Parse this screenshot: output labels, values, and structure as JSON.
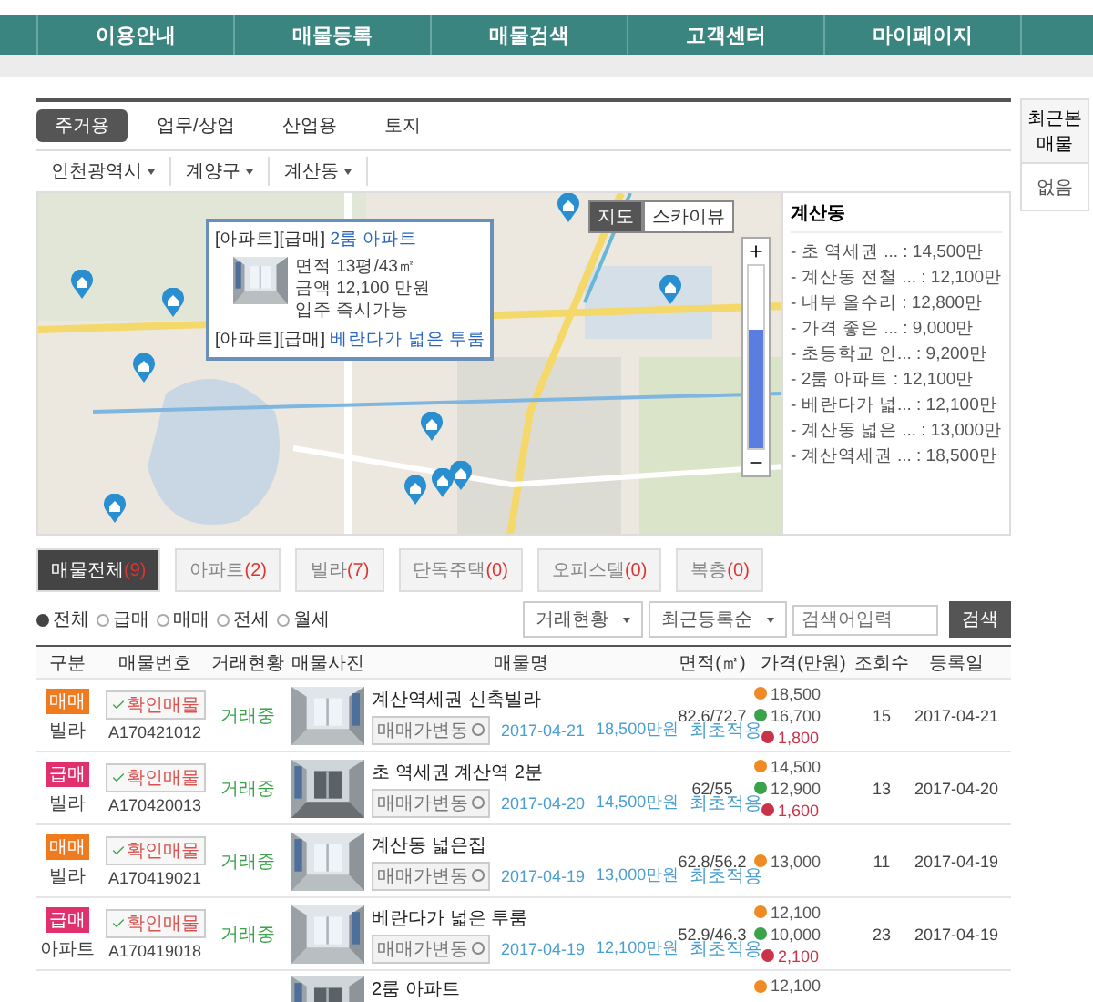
{
  "nav": [
    "이용안내",
    "매물등록",
    "매물검색",
    "고객센터",
    "마이페이지"
  ],
  "category_tabs": [
    {
      "label": "주거용",
      "selected": true
    },
    {
      "label": "업무/상업",
      "selected": false
    },
    {
      "label": "산업용",
      "selected": false
    },
    {
      "label": "토지",
      "selected": false
    }
  ],
  "breadcrumb": [
    "인천광역시",
    "계양구",
    "계산동"
  ],
  "map": {
    "map_types": [
      {
        "label": "지도",
        "selected": true
      },
      {
        "label": "스카이뷰",
        "selected": false
      }
    ],
    "zoom": {
      "level": 0.65
    },
    "popup": {
      "items": [
        {
          "tags": "[아파트][급매]",
          "title": "2룸 아파트",
          "details": [
            "면적 13평/43㎡",
            "금액 12,100 만원",
            "입주 즉시가능"
          ]
        },
        {
          "tags": "[아파트][급매]",
          "title": "베란다가 넓은 투룸"
        }
      ]
    },
    "list": {
      "title": "계산동",
      "items": [
        "- 초 역세권 ... : 14,500만",
        "- 계산동 전철 ... : 12,100만",
        "- 내부 올수리 : 12,800만",
        "- 가격 좋은 ... : 9,000만",
        "- 초등학교 인... : 9,200만",
        "- 2룸 아파트 : 12,100만",
        "- 베란다가 넓... : 12,100만",
        "- 계산동 넓은 ... : 13,000만",
        "- 계산역세권 ... : 18,500만"
      ]
    }
  },
  "property_tabs": [
    {
      "label": "매물전체",
      "count": "(9)",
      "selected": true
    },
    {
      "label": "아파트",
      "count": "(2)",
      "selected": false
    },
    {
      "label": "빌라",
      "count": "(7)",
      "selected": false
    },
    {
      "label": "단독주택",
      "count": "(0)",
      "selected": false
    },
    {
      "label": "오피스텔",
      "count": "(0)",
      "selected": false
    },
    {
      "label": "복층",
      "count": "(0)",
      "selected": false
    }
  ],
  "filter": {
    "options": [
      {
        "label": "전체",
        "selected": true
      },
      {
        "label": "급매",
        "selected": false
      },
      {
        "label": "매매",
        "selected": false
      },
      {
        "label": "전세",
        "selected": false
      },
      {
        "label": "월세",
        "selected": false
      }
    ],
    "selects": [
      "거래현황",
      "최근등록순"
    ],
    "search": {
      "placeholder": "검색어입력"
    },
    "button": "검색"
  },
  "table": {
    "columns": [
      "구분",
      "매물번호",
      "거래현황",
      "매물사진",
      "매물명",
      "면적(㎡)",
      "가격(만원)",
      "조회수",
      "등록일"
    ],
    "rows": [
      {
        "tag": {
          "label": "매매",
          "color": "#f07a1e"
        },
        "type": "빌라",
        "verified": "확인매물",
        "id": "A170421012",
        "status": "거래중",
        "name": "계산역세권 신축빌라",
        "change": "매매가변동",
        "date": "2017-04-21",
        "price": "18,500만원",
        "note": "최초적용",
        "area": "82.6/72.7",
        "prices": [
          {
            "kind": "sale",
            "value": "18,500"
          },
          {
            "kind": "loan",
            "value": "16,700"
          },
          {
            "kind": "gap",
            "value": "1,800"
          }
        ],
        "views": "15",
        "registered": "2017-04-21"
      },
      {
        "tag": {
          "label": "급매",
          "color": "#e0306e"
        },
        "type": "빌라",
        "verified": "확인매물",
        "id": "A170420013",
        "status": "거래중",
        "name": "초 역세권 계산역 2분",
        "change": "매매가변동",
        "date": "2017-04-20",
        "price": "14,500만원",
        "note": "최초적용",
        "area": "62/55",
        "prices": [
          {
            "kind": "sale",
            "value": "14,500"
          },
          {
            "kind": "loan",
            "value": "12,900"
          },
          {
            "kind": "gap",
            "value": "1,600"
          }
        ],
        "views": "13",
        "registered": "2017-04-20"
      },
      {
        "tag": {
          "label": "매매",
          "color": "#f07a1e"
        },
        "type": "빌라",
        "verified": "확인매물",
        "id": "A170419021",
        "status": "거래중",
        "name": "계산동 넓은집",
        "change": "매매가변동",
        "date": "2017-04-19",
        "price": "13,000만원",
        "note": "최초적용",
        "area": "62.8/56.2",
        "prices": [
          {
            "kind": "sale",
            "value": "13,000"
          }
        ],
        "views": "11",
        "registered": "2017-04-19"
      },
      {
        "tag": {
          "label": "급매",
          "color": "#e0306e"
        },
        "type": "아파트",
        "verified": "확인매물",
        "id": "A170419018",
        "status": "거래중",
        "name": "베란다가 넓은 투룸",
        "change": "매매가변동",
        "date": "2017-04-19",
        "price": "12,100만원",
        "note": "최초적용",
        "area": "52.9/46.3",
        "prices": [
          {
            "kind": "sale",
            "value": "12,100"
          },
          {
            "kind": "loan",
            "value": "10,000"
          },
          {
            "kind": "gap",
            "value": "2,100"
          }
        ],
        "views": "23",
        "registered": "2017-04-19"
      },
      {
        "name": "2룸 아파트",
        "prices": [
          {
            "kind": "sale",
            "value": "12,100"
          }
        ]
      }
    ]
  },
  "sidebar": {
    "title": "최근본매물",
    "empty": "없음"
  }
}
